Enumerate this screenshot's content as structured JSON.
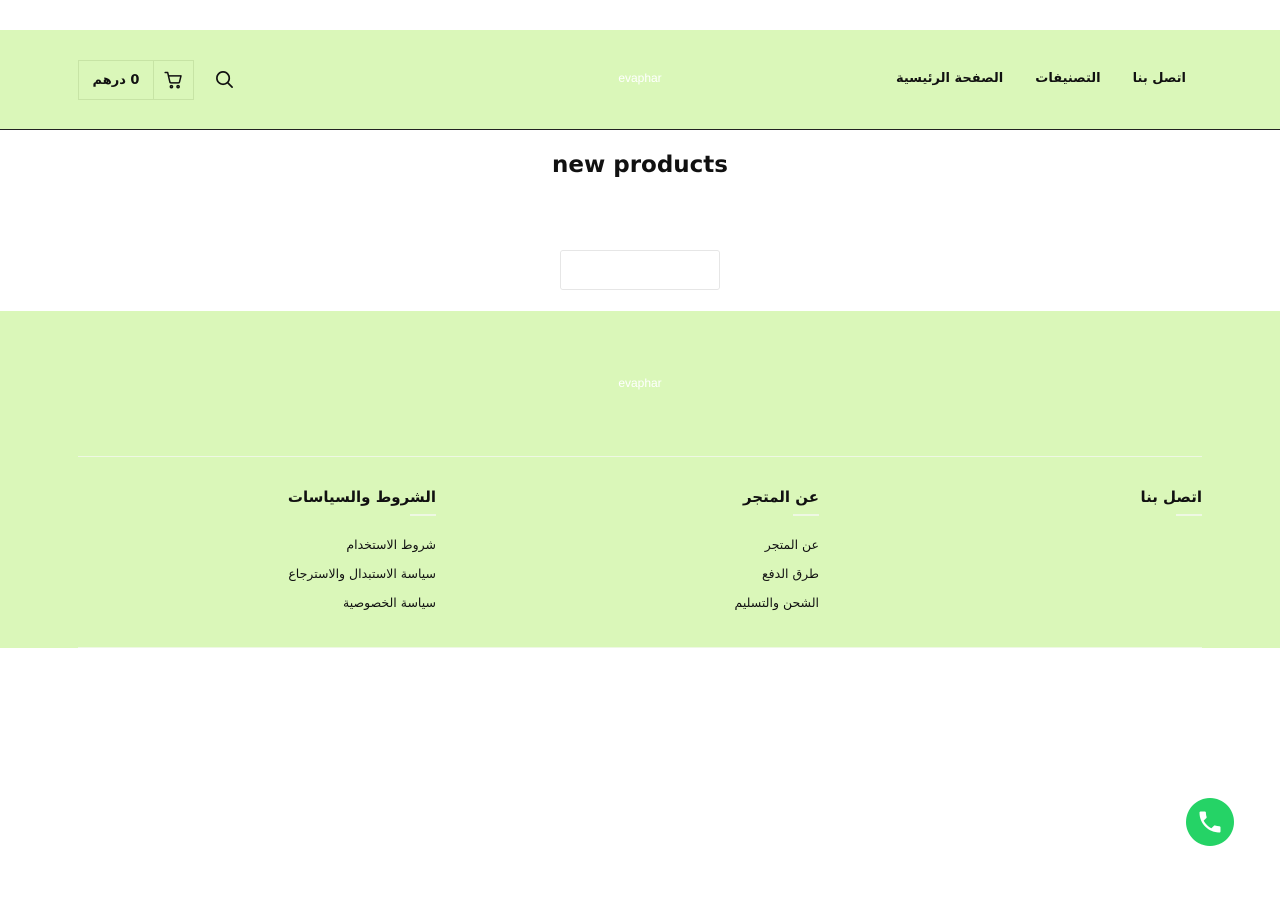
{
  "header": {
    "brand": "evaphar",
    "nav": [
      {
        "label": "الصفحة الرئيسية"
      },
      {
        "label": "التصنيفات"
      },
      {
        "label": "اتصل بنا"
      }
    ],
    "cart_amount": "0 درهم",
    "icons": [
      "cart-icon",
      "search-icon"
    ]
  },
  "main": {
    "section_title": "new products"
  },
  "footer": {
    "brand": "evaphar",
    "columns": [
      {
        "title": "اتصل بنا",
        "links": []
      },
      {
        "title": "عن المتجر",
        "links": [
          {
            "label": "عن المتجر"
          },
          {
            "label": "طرق الدفع"
          },
          {
            "label": "الشحن والتسليم"
          }
        ]
      },
      {
        "title": "الشروط والسياسات",
        "links": [
          {
            "label": "شروط الاستخدام"
          },
          {
            "label": "سياسة الاستبدال والاسترجاع"
          },
          {
            "label": "سياسة الخصوصية"
          }
        ]
      }
    ]
  },
  "floating": {
    "whatsapp_icon": "whatsapp-icon"
  },
  "colors": {
    "header_bg": "#daf7b9",
    "footer_bg": "#daf7b9",
    "whatsapp": "#25d366"
  }
}
